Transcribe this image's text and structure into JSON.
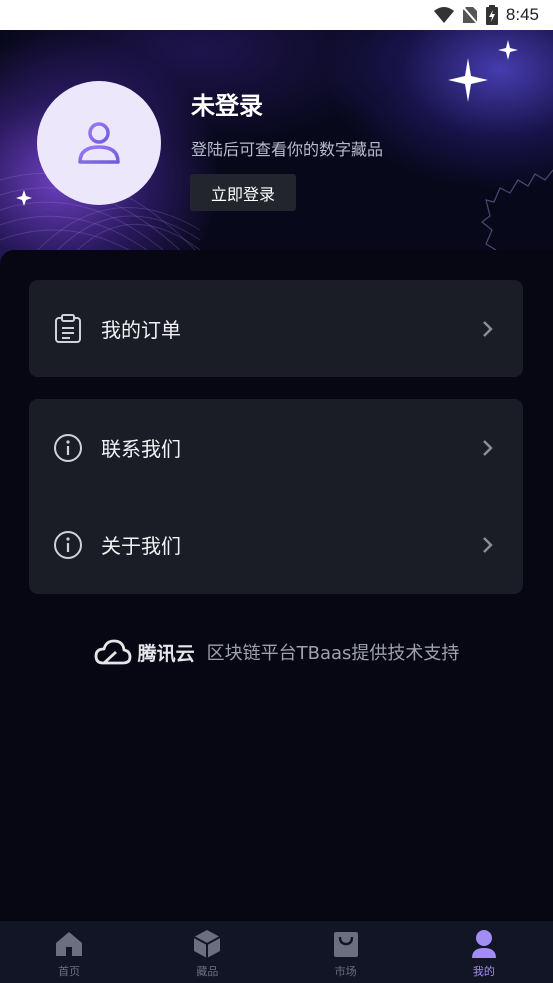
{
  "status_bar": {
    "time": "8:45"
  },
  "profile": {
    "title": "未登录",
    "subtitle": "登陆后可查看你的数字藏品",
    "login_label": "立即登录"
  },
  "menu": {
    "orders": {
      "label": "我的订单",
      "icon": "clipboard-icon"
    },
    "contact": {
      "label": "联系我们",
      "icon": "info-icon"
    },
    "about": {
      "label": "关于我们",
      "icon": "info-icon"
    }
  },
  "footer": {
    "brand": "腾讯云",
    "support": "区块链平台TBaas提供技术支持"
  },
  "nav": {
    "items": [
      {
        "label": "首页",
        "icon": "home-icon"
      },
      {
        "label": "藏品",
        "icon": "cube-icon"
      },
      {
        "label": "市场",
        "icon": "shopping-bag-icon"
      },
      {
        "label": "我的",
        "icon": "user-icon",
        "active": true
      }
    ]
  },
  "colors": {
    "accent": "#a38cf5",
    "card": "#1a1d26",
    "background": "#050611"
  }
}
